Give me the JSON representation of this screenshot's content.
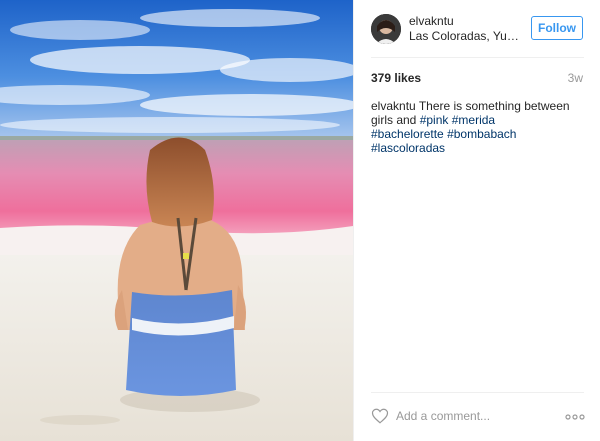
{
  "post": {
    "image_alt": "Woman sitting on beach facing pink lagoon",
    "username": "elvakntu",
    "location": "Las Coloradas, Yucat...",
    "follow_label": "Follow",
    "likes": "379 likes",
    "age": "3w",
    "caption": {
      "user": "elvakntu",
      "text": "There is something between girls and",
      "hashtags": [
        "#pink",
        "#merida",
        "#bachelorette",
        "#bombabach",
        "#lascoloradas"
      ]
    },
    "comment_placeholder": "Add a comment...",
    "icons": {
      "like": "heart-icon",
      "more": "more-options-icon"
    },
    "colors": {
      "accent": "#3897f0",
      "hashtag": "#003569",
      "muted": "#999999"
    }
  }
}
